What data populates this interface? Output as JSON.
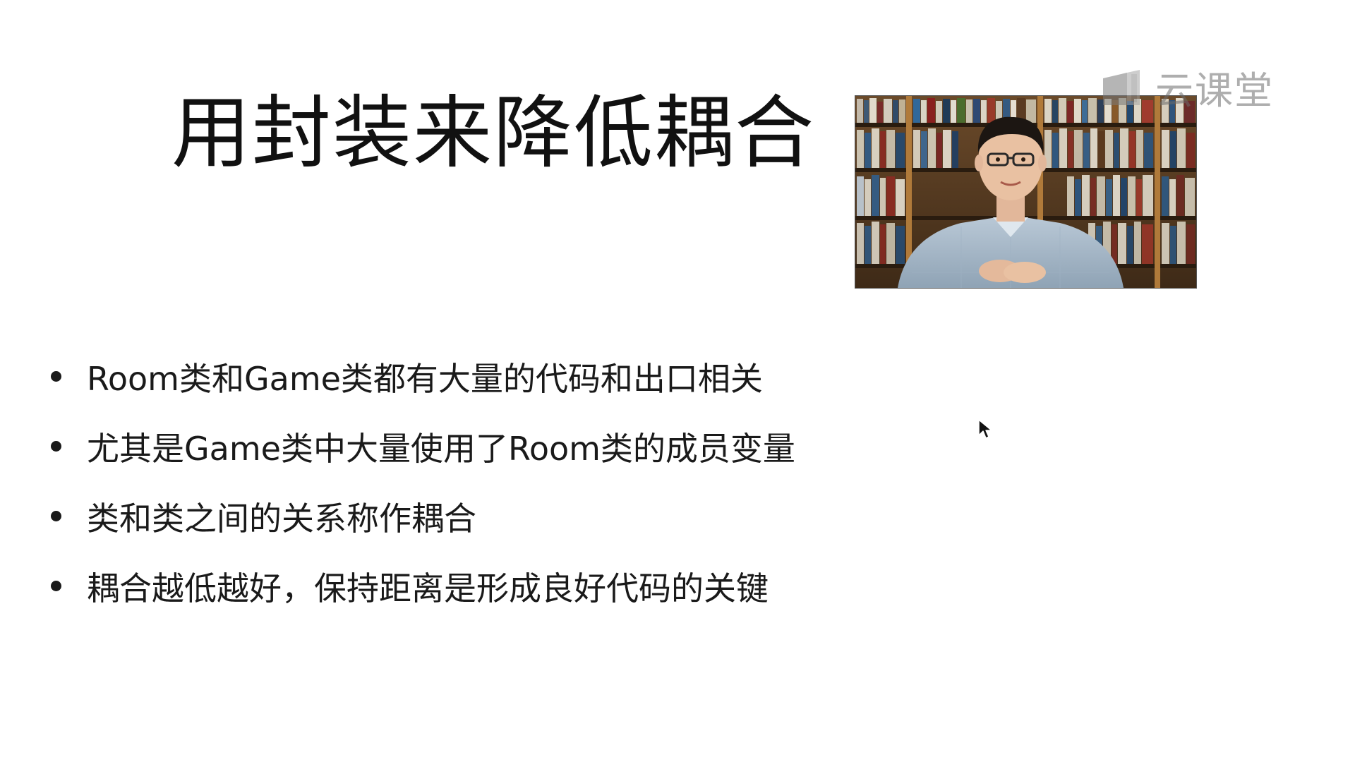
{
  "slide": {
    "title": "用封装来降低耦合",
    "bullets": [
      "Room类和Game类都有大量的代码和出口相关",
      "尤其是Game类中大量使用了Room类的成员变量",
      "类和类之间的关系称作耦合",
      "耦合越低越好，保持距离是形成良好代码的关键"
    ]
  },
  "video": {
    "content": "instructor-webcam",
    "icon": "presenter-video"
  },
  "watermark": {
    "text": "云课堂",
    "icon": "cloud-classroom-logo-icon"
  },
  "cursor": {
    "icon": "mouse-pointer-icon"
  },
  "colors": {
    "background": "#ffffff",
    "text": "#1a1a1a",
    "watermark": "#6c6c6c"
  }
}
